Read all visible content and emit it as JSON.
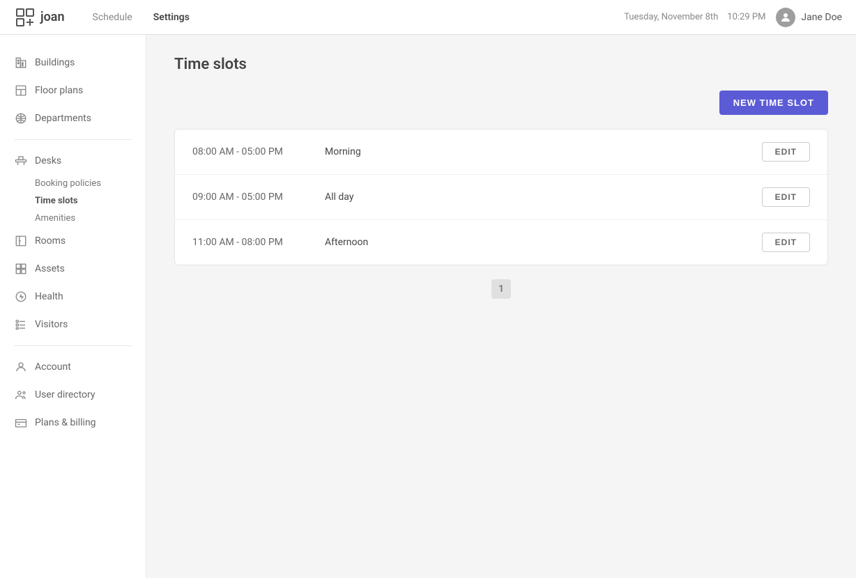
{
  "topnav": {
    "logo_text": "joan",
    "nav_links": [
      {
        "label": "Schedule",
        "active": false
      },
      {
        "label": "Settings",
        "active": true
      }
    ],
    "datetime": "Tuesday, November 8th",
    "time": "10:29 PM",
    "user": "Jane Doe"
  },
  "sidebar": {
    "group1": [
      {
        "id": "buildings",
        "label": "Buildings",
        "icon": "buildings"
      },
      {
        "id": "floor-plans",
        "label": "Floor plans",
        "icon": "floor-plans"
      },
      {
        "id": "departments",
        "label": "Departments",
        "icon": "departments"
      }
    ],
    "group2": [
      {
        "id": "desks",
        "label": "Desks",
        "icon": "desks",
        "sub": [
          {
            "label": "Booking policies",
            "active": false
          },
          {
            "label": "Time slots",
            "active": true
          },
          {
            "label": "Amenities",
            "active": false
          }
        ]
      },
      {
        "id": "rooms",
        "label": "Rooms",
        "icon": "rooms"
      },
      {
        "id": "assets",
        "label": "Assets",
        "icon": "assets"
      },
      {
        "id": "health",
        "label": "Health",
        "icon": "health"
      },
      {
        "id": "visitors",
        "label": "Visitors",
        "icon": "visitors"
      }
    ],
    "group3": [
      {
        "id": "account",
        "label": "Account",
        "icon": "account"
      },
      {
        "id": "user-directory",
        "label": "User directory",
        "icon": "users"
      },
      {
        "id": "plans-billing",
        "label": "Plans & billing",
        "icon": "billing"
      }
    ]
  },
  "main": {
    "title": "Time slots",
    "new_button": "NEW TIME SLOT",
    "timeslots": [
      {
        "time": "08:00 AM - 05:00 PM",
        "name": "Morning",
        "edit": "EDIT"
      },
      {
        "time": "09:00 AM - 05:00 PM",
        "name": "All day",
        "edit": "EDIT"
      },
      {
        "time": "11:00 AM - 08:00 PM",
        "name": "Afternoon",
        "edit": "EDIT"
      }
    ],
    "pagination": [
      "1"
    ]
  }
}
